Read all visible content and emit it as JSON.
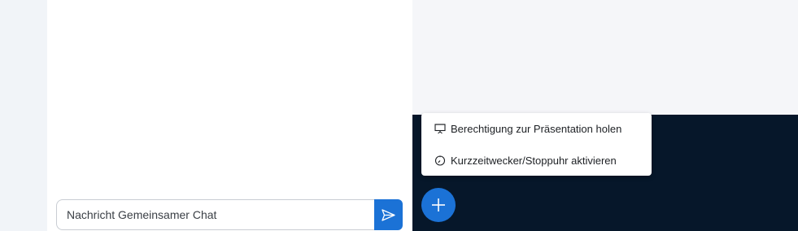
{
  "chat": {
    "input_placeholder": "Nachricht Gemeinsamer Chat",
    "send_icon": "send-icon"
  },
  "actions_menu": {
    "items": [
      {
        "label": "Berechtigung zur Präsentation holen",
        "icon": "presentation-icon"
      },
      {
        "label": "Kurzzeitwecker/Stoppuhr aktivieren",
        "icon": "stopwatch-icon"
      }
    ]
  },
  "actions_button": {
    "icon": "plus-icon"
  },
  "colors": {
    "accent": "#1b72d6",
    "presentation_background": "#06172a",
    "chat_background": "#ffffff",
    "page_background": "#f1f4f8"
  }
}
